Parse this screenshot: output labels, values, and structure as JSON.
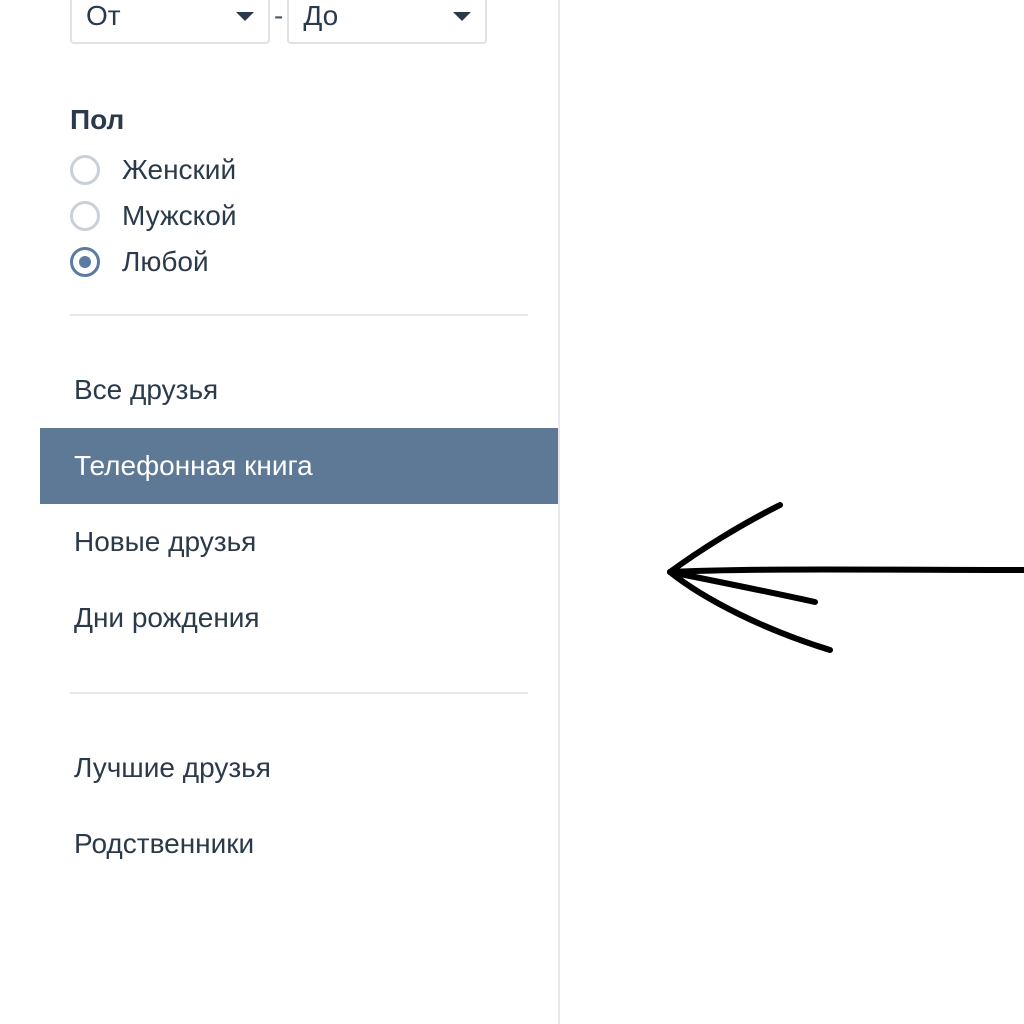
{
  "range": {
    "from_label": "От",
    "to_label": "До",
    "dash": "-"
  },
  "gender": {
    "title": "Пол",
    "options": [
      {
        "label": "Женский",
        "checked": false
      },
      {
        "label": "Мужской",
        "checked": false
      },
      {
        "label": "Любой",
        "checked": true
      }
    ]
  },
  "main_tabs": {
    "items": [
      {
        "label": "Все друзья",
        "selected": false
      },
      {
        "label": "Телефонная книга",
        "selected": true
      },
      {
        "label": "Новые друзья",
        "selected": false
      },
      {
        "label": "Дни рождения",
        "selected": false
      }
    ]
  },
  "sub_tabs": {
    "items": [
      {
        "label": "Лучшие друзья"
      },
      {
        "label": "Родственники"
      }
    ]
  },
  "colors": {
    "selected_bg": "#5d7996",
    "text": "#2b3a4a",
    "border": "#e6e8eb"
  }
}
